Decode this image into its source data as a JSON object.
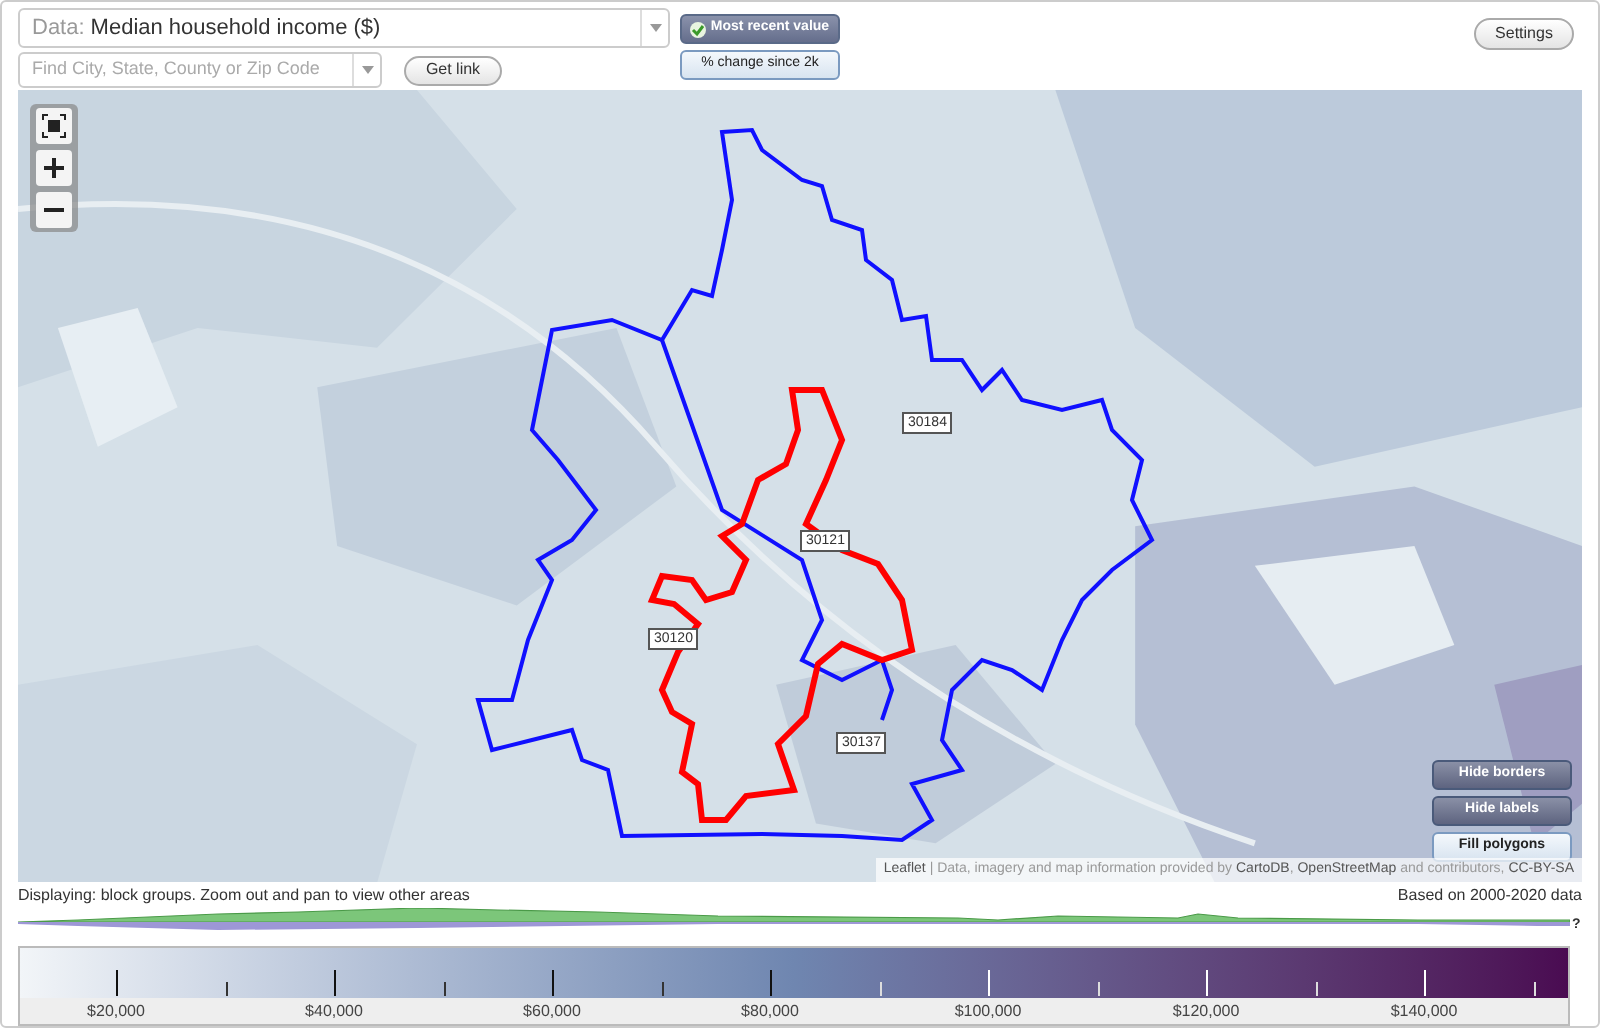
{
  "data_select": {
    "label": "Data:",
    "value": "Median household income ($)"
  },
  "location_search": {
    "placeholder": "Find City, State, County or Zip Code"
  },
  "get_link": {
    "label": "Get link"
  },
  "value_modes": [
    {
      "label": "Most recent value",
      "selected": true
    },
    {
      "label": "% change since 2k",
      "selected": false
    }
  ],
  "settings": {
    "label": "Settings"
  },
  "map": {
    "zoom_controls": [
      {
        "kind": "fit"
      },
      {
        "kind": "zoom-in"
      },
      {
        "kind": "zoom-out"
      }
    ],
    "zip_labels": [
      "30184",
      "30121",
      "30120",
      "30137"
    ],
    "toggles": [
      {
        "label": "Hide borders",
        "selected": true
      },
      {
        "label": "Hide labels",
        "selected": true
      },
      {
        "label": "Fill polygons",
        "selected": false
      }
    ],
    "attribution": [
      {
        "text": "Leaflet",
        "link": true
      },
      {
        "text": " | Data, imagery and map information provided by ",
        "link": false
      },
      {
        "text": "CartoDB",
        "link": true
      },
      {
        "text": ", ",
        "link": false
      },
      {
        "text": "OpenStreetMap",
        "link": true
      },
      {
        "text": " and contributors, ",
        "link": false
      },
      {
        "text": "CC-BY-SA",
        "link": true
      }
    ]
  },
  "status": {
    "left": "Displaying: block groups. Zoom out and pan to view other areas",
    "right": "Based on 2000-2020 data"
  },
  "histogram": {
    "help": "?"
  },
  "legend": {
    "labels": [
      "$20,000",
      "$40,000",
      "$60,000",
      "$80,000",
      "$100,000",
      "$120,000",
      "$140,000"
    ]
  }
}
